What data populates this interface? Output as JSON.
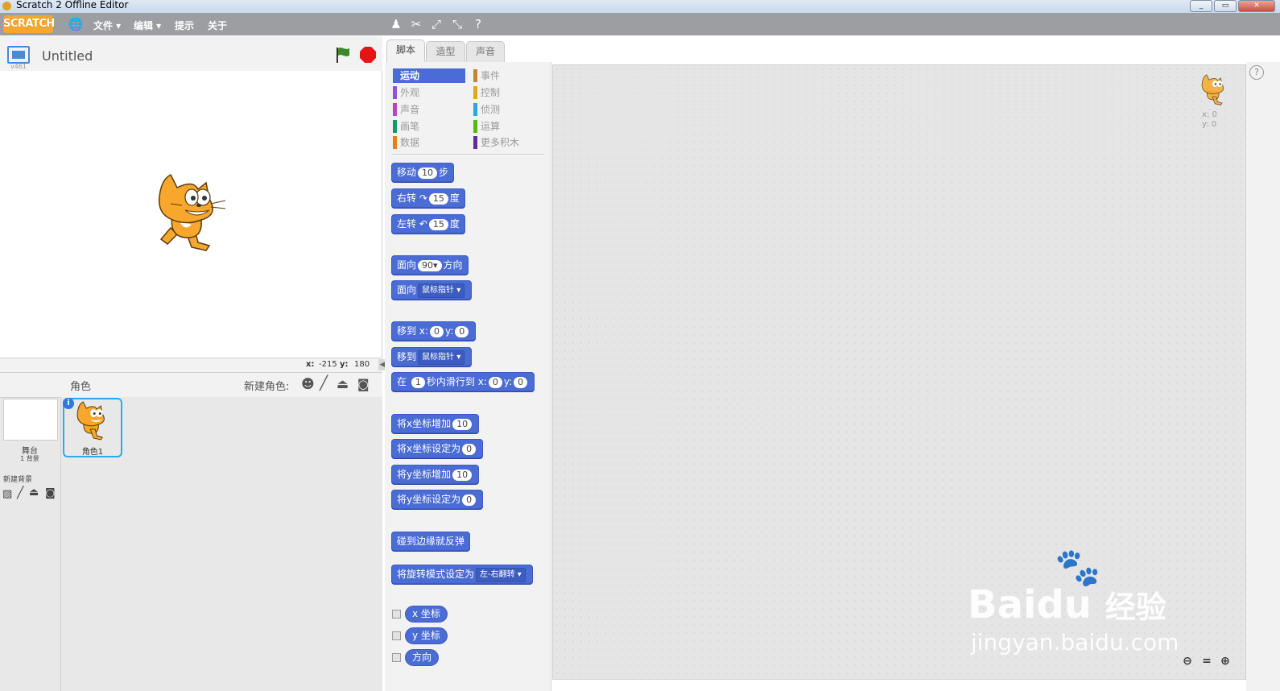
{
  "window": {
    "title": "Scratch 2 Offline Editor",
    "controls": [
      "_",
      "▭",
      "✕"
    ]
  },
  "menubar": {
    "logo": "SCRATCH",
    "items": [
      "文件 ▾",
      "编辑 ▾",
      "提示",
      "关于"
    ]
  },
  "stage": {
    "project_title": "Untitled",
    "version": "v461",
    "coords": {
      "x_label": "x:",
      "x": "-215",
      "y_label": "y:",
      "y": "180"
    }
  },
  "sprite_pane": {
    "title": "角色",
    "new_sprite_label": "新建角色:",
    "stage_label": "舞台",
    "backdrop_count": "1 背景",
    "new_backdrop_label": "新建背景",
    "sprites": [
      {
        "name": "角色1"
      }
    ]
  },
  "tabs": [
    "脚本",
    "造型",
    "声音"
  ],
  "categories": [
    {
      "label": "运动",
      "color": "#4a6cd4"
    },
    {
      "label": "事件",
      "color": "#c88330"
    },
    {
      "label": "外观",
      "color": "#8a55d7"
    },
    {
      "label": "控制",
      "color": "#e1a91a"
    },
    {
      "label": "声音",
      "color": "#bb42c3"
    },
    {
      "label": "侦测",
      "color": "#2ca5e2"
    },
    {
      "label": "画笔",
      "color": "#0e9a6c"
    },
    {
      "label": "运算",
      "color": "#5cb712"
    },
    {
      "label": "数据",
      "color": "#ee7d16"
    },
    {
      "label": "更多积木",
      "color": "#632d99"
    }
  ],
  "blocks": {
    "move": {
      "pre": "移动",
      "val": "10",
      "post": "步"
    },
    "turn_right": {
      "pre": "右转",
      "icon": "↷",
      "val": "15",
      "post": "度"
    },
    "turn_left": {
      "pre": "左转",
      "icon": "↶",
      "val": "15",
      "post": "度"
    },
    "point_dir": {
      "pre": "面向",
      "val": "90▾",
      "post": "方向"
    },
    "point_towards": {
      "pre": "面向",
      "dd": "鼠标指针 ▾"
    },
    "goto_xy": {
      "pre": "移到",
      "x_label": "x:",
      "x": "0",
      "y_label": "y:",
      "y": "0"
    },
    "goto": {
      "pre": "移到",
      "dd": "鼠标指针 ▾"
    },
    "glide": {
      "pre": "在",
      "secs": "1",
      "mid": "秒内滑行到",
      "x_label": "x:",
      "x": "0",
      "y_label": "y:",
      "y": "0"
    },
    "change_x": {
      "pre": "将x坐标增加",
      "val": "10"
    },
    "set_x": {
      "pre": "将x坐标设定为",
      "val": "0"
    },
    "change_y": {
      "pre": "将y坐标增加",
      "val": "10"
    },
    "set_y": {
      "pre": "将y坐标设定为",
      "val": "0"
    },
    "bounce": {
      "pre": "碰到边缘就反弹"
    },
    "rotation_style": {
      "pre": "将旋转模式设定为",
      "dd": "左-右翻转 ▾"
    },
    "reporters": [
      "x 坐标",
      "y 坐标",
      "方向"
    ]
  },
  "script_area": {
    "sprite_x": "x: 0",
    "sprite_y": "y: 0"
  },
  "watermark": {
    "brand": "Bai",
    "du": "du",
    "cn": "经验",
    "url": "jingyan.baidu.com"
  }
}
